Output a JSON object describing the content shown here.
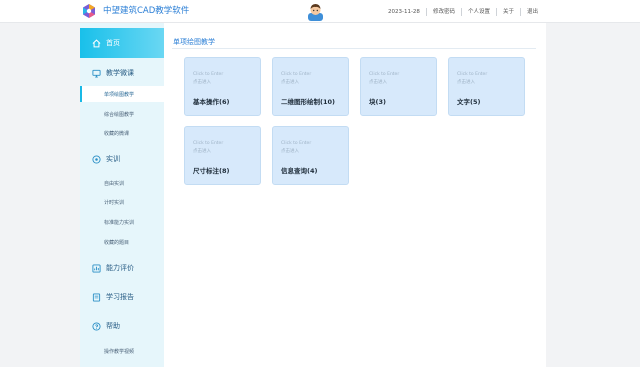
{
  "header": {
    "app_title": "中望建筑CAD教学软件",
    "date": "2023-11-28",
    "links": [
      "修改密码",
      "个人设置",
      "关于",
      "退出"
    ]
  },
  "sidebar": {
    "home": "首页",
    "sections": [
      {
        "label": "教学微课",
        "icon": "monitor-icon",
        "items": [
          "单项绘图教学",
          "综合绘图教学",
          "收藏的微课"
        ]
      },
      {
        "label": "实训",
        "icon": "target-icon",
        "items": [
          "自由实训",
          "计时实训",
          "标准能力实训",
          "收藏的题目"
        ]
      },
      {
        "label": "能力评价",
        "icon": "chart-icon",
        "items": []
      },
      {
        "label": "学习报告",
        "icon": "book-icon",
        "items": []
      },
      {
        "label": "帮助",
        "icon": "help-icon",
        "items": [
          "操作教学视频"
        ]
      }
    ],
    "active_item": "单项绘图教学"
  },
  "main": {
    "title": "单项绘图教学",
    "cards": [
      {
        "hint_en": "Click to Enter",
        "hint_cn": "点击进入",
        "name": "基本操作(6)"
      },
      {
        "hint_en": "Click to Enter",
        "hint_cn": "点击进入",
        "name": "二维图形绘制(10)"
      },
      {
        "hint_en": "Click to Enter",
        "hint_cn": "点击进入",
        "name": "块(3)"
      },
      {
        "hint_en": "Click to Enter",
        "hint_cn": "点击进入",
        "name": "文字(5)"
      },
      {
        "hint_en": "Click to Enter",
        "hint_cn": "点击进入",
        "name": "尺寸标注(8)"
      },
      {
        "hint_en": "Click to Enter",
        "hint_cn": "点击进入",
        "name": "信息查询(4)"
      }
    ]
  },
  "colors": {
    "accent": "#19c0ea",
    "brand_text": "#2b7fd6",
    "card_bg": "#d7e9fb",
    "sidebar_bg": "#e6f6fb"
  }
}
